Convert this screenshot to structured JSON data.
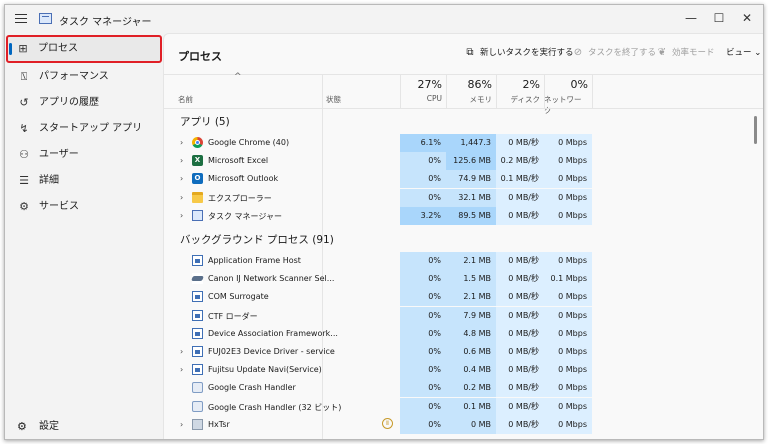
{
  "window": {
    "title": "タスク マネージャー",
    "controls": {
      "minimize": "—",
      "maximize": "☐",
      "close": "✕"
    }
  },
  "sidebar": {
    "items": [
      {
        "label": "プロセス",
        "icon": "processes-icon",
        "active": true
      },
      {
        "label": "パフォーマンス",
        "icon": "performance-icon"
      },
      {
        "label": "アプリの履歴",
        "icon": "history-icon"
      },
      {
        "label": "スタートアップ アプリ",
        "icon": "startup-icon"
      },
      {
        "label": "ユーザー",
        "icon": "users-icon"
      },
      {
        "label": "詳細",
        "icon": "details-icon"
      },
      {
        "label": "サービス",
        "icon": "services-icon"
      }
    ],
    "settings_label": "設定"
  },
  "main": {
    "title": "プロセス",
    "toolbar": {
      "run_new_task": "新しいタスクを実行する",
      "end_task": "タスクを終了する",
      "efficiency_mode": "効率モード",
      "view": "ビュー"
    },
    "columns": {
      "name": "名前",
      "status": "状態",
      "cpu": {
        "pct": "27%",
        "label": "CPU"
      },
      "memory": {
        "pct": "86%",
        "label": "メモリ"
      },
      "disk": {
        "pct": "2%",
        "label": "ディスク"
      },
      "network": {
        "pct": "0%",
        "label": "ネットワーク"
      }
    },
    "apps_section": "アプリ (5)",
    "apps": [
      {
        "name": "Google Chrome (40)",
        "icon": "chrome-icon",
        "expand": true,
        "cpu": "6.1%",
        "mem": "1,447.3 MB",
        "disk": "0 MB/秒",
        "net": "0 Mbps"
      },
      {
        "name": "Microsoft Excel",
        "icon": "excel-icon",
        "expand": true,
        "cpu": "0%",
        "mem": "125.6 MB",
        "disk": "0.2 MB/秒",
        "net": "0 Mbps"
      },
      {
        "name": "Microsoft Outlook",
        "icon": "outlook-icon",
        "expand": true,
        "cpu": "0%",
        "mem": "74.9 MB",
        "disk": "0.1 MB/秒",
        "net": "0 Mbps"
      },
      {
        "name": "エクスプローラー",
        "icon": "folder-icon",
        "expand": true,
        "cpu": "0%",
        "mem": "32.1 MB",
        "disk": "0 MB/秒",
        "net": "0 Mbps"
      },
      {
        "name": "タスク マネージャー",
        "icon": "task-manager-icon",
        "expand": true,
        "cpu": "3.2%",
        "mem": "89.5 MB",
        "disk": "0 MB/秒",
        "net": "0 Mbps"
      }
    ],
    "bg_section": "バックグラウンド プロセス (91)",
    "bg": [
      {
        "name": "Application Frame Host",
        "icon": "app-icon",
        "expand": false,
        "cpu": "0%",
        "mem": "2.1 MB",
        "disk": "0 MB/秒",
        "net": "0 Mbps"
      },
      {
        "name": "Canon IJ Network Scanner Sel...",
        "icon": "scanner-icon",
        "expand": false,
        "cpu": "0%",
        "mem": "1.5 MB",
        "disk": "0 MB/秒",
        "net": "0.1 Mbps"
      },
      {
        "name": "COM Surrogate",
        "icon": "app-icon",
        "expand": false,
        "cpu": "0%",
        "mem": "2.1 MB",
        "disk": "0 MB/秒",
        "net": "0 Mbps"
      },
      {
        "name": "CTF ローダー",
        "icon": "app-icon",
        "expand": false,
        "cpu": "0%",
        "mem": "7.9 MB",
        "disk": "0 MB/秒",
        "net": "0 Mbps"
      },
      {
        "name": "Device Association Framework...",
        "icon": "app-icon",
        "expand": false,
        "cpu": "0%",
        "mem": "4.8 MB",
        "disk": "0 MB/秒",
        "net": "0 Mbps"
      },
      {
        "name": "FUJ02E3 Device Driver - service",
        "icon": "app-icon",
        "expand": true,
        "cpu": "0%",
        "mem": "0.6 MB",
        "disk": "0 MB/秒",
        "net": "0 Mbps"
      },
      {
        "name": "Fujitsu Update Navi(Service)",
        "icon": "app-icon",
        "expand": true,
        "cpu": "0%",
        "mem": "0.4 MB",
        "disk": "0 MB/秒",
        "net": "0 Mbps"
      },
      {
        "name": "Google Crash Handler",
        "icon": "crash-handler-icon",
        "expand": false,
        "cpu": "0%",
        "mem": "0.2 MB",
        "disk": "0 MB/秒",
        "net": "0 Mbps"
      },
      {
        "name": "Google Crash Handler (32 ビット)",
        "icon": "crash-handler-icon",
        "expand": false,
        "cpu": "0%",
        "mem": "0.1 MB",
        "disk": "0 MB/秒",
        "net": "0 Mbps"
      },
      {
        "name": "HxTsr",
        "icon": "hxtsr-icon",
        "expand": true,
        "status_icon": "paused-icon",
        "cpu": "0%",
        "mem": "0 MB",
        "disk": "0 MB/秒",
        "net": "0 Mbps"
      }
    ]
  }
}
